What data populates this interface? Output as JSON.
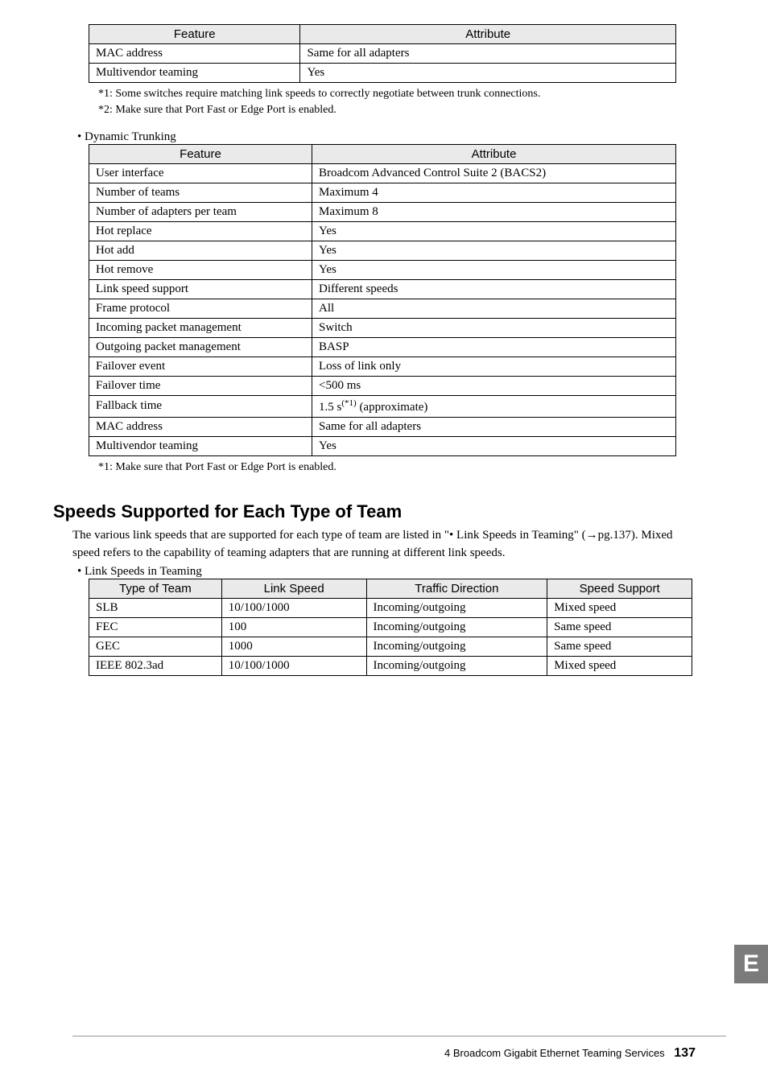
{
  "table1": {
    "headers": [
      "Feature",
      "Attribute"
    ],
    "rows": [
      [
        "MAC address",
        "Same for all adapters"
      ],
      [
        "Multivendor teaming",
        "Yes"
      ]
    ],
    "notes": [
      "*1: Some switches require matching link speeds to correctly negotiate between trunk connections.",
      "*2: Make sure that Port Fast or Edge Port is enabled."
    ]
  },
  "dynamic_bullet": "•  Dynamic Trunking",
  "table2": {
    "headers": [
      "Feature",
      "Attribute"
    ],
    "rows": [
      [
        "User interface",
        "Broadcom Advanced Control Suite 2 (BACS2)"
      ],
      [
        "Number of teams",
        "Maximum 4"
      ],
      [
        "Number of adapters per team",
        "Maximum 8"
      ],
      [
        "Hot replace",
        "Yes"
      ],
      [
        "Hot add",
        "Yes"
      ],
      [
        "Hot remove",
        "Yes"
      ],
      [
        "Link speed support",
        "Different speeds"
      ],
      [
        "Frame protocol",
        "All"
      ],
      [
        "Incoming packet management",
        "Switch"
      ],
      [
        "Outgoing packet management",
        "BASP"
      ],
      [
        "Failover event",
        "Loss of link only"
      ],
      [
        "Failover time",
        "<500 ms"
      ],
      [
        "Fallback time",
        "1.5 s(*1) (approximate)"
      ],
      [
        "MAC address",
        "Same for all adapters"
      ],
      [
        "Multivendor teaming",
        "Yes"
      ]
    ],
    "note": "*1: Make sure that Port Fast or Edge Port is enabled."
  },
  "section_title": "Speeds Supported for Each Type of Team",
  "section_body": "The various link speeds that are supported for each type of team are listed in \"• Link Speeds in Teaming\" (→pg.137). Mixed speed refers to the capability of teaming adapters that are running at different link speeds.",
  "speed_bullet": "•  Link Speeds in Teaming",
  "table3": {
    "headers": [
      "Type of Team",
      "Link Speed",
      "Traffic Direction",
      "Speed Support"
    ],
    "rows": [
      [
        "SLB",
        "10/100/1000",
        "Incoming/outgoing",
        "Mixed speed"
      ],
      [
        "FEC",
        "100",
        "Incoming/outgoing",
        "Same speed"
      ],
      [
        "GEC",
        "1000",
        "Incoming/outgoing",
        "Same speed"
      ],
      [
        "IEEE 802.3ad",
        "10/100/1000",
        "Incoming/outgoing",
        "Mixed speed"
      ]
    ]
  },
  "side_tab": "E",
  "footer": {
    "text": "4  Broadcom Gigabit Ethernet Teaming Services",
    "page": "137"
  }
}
